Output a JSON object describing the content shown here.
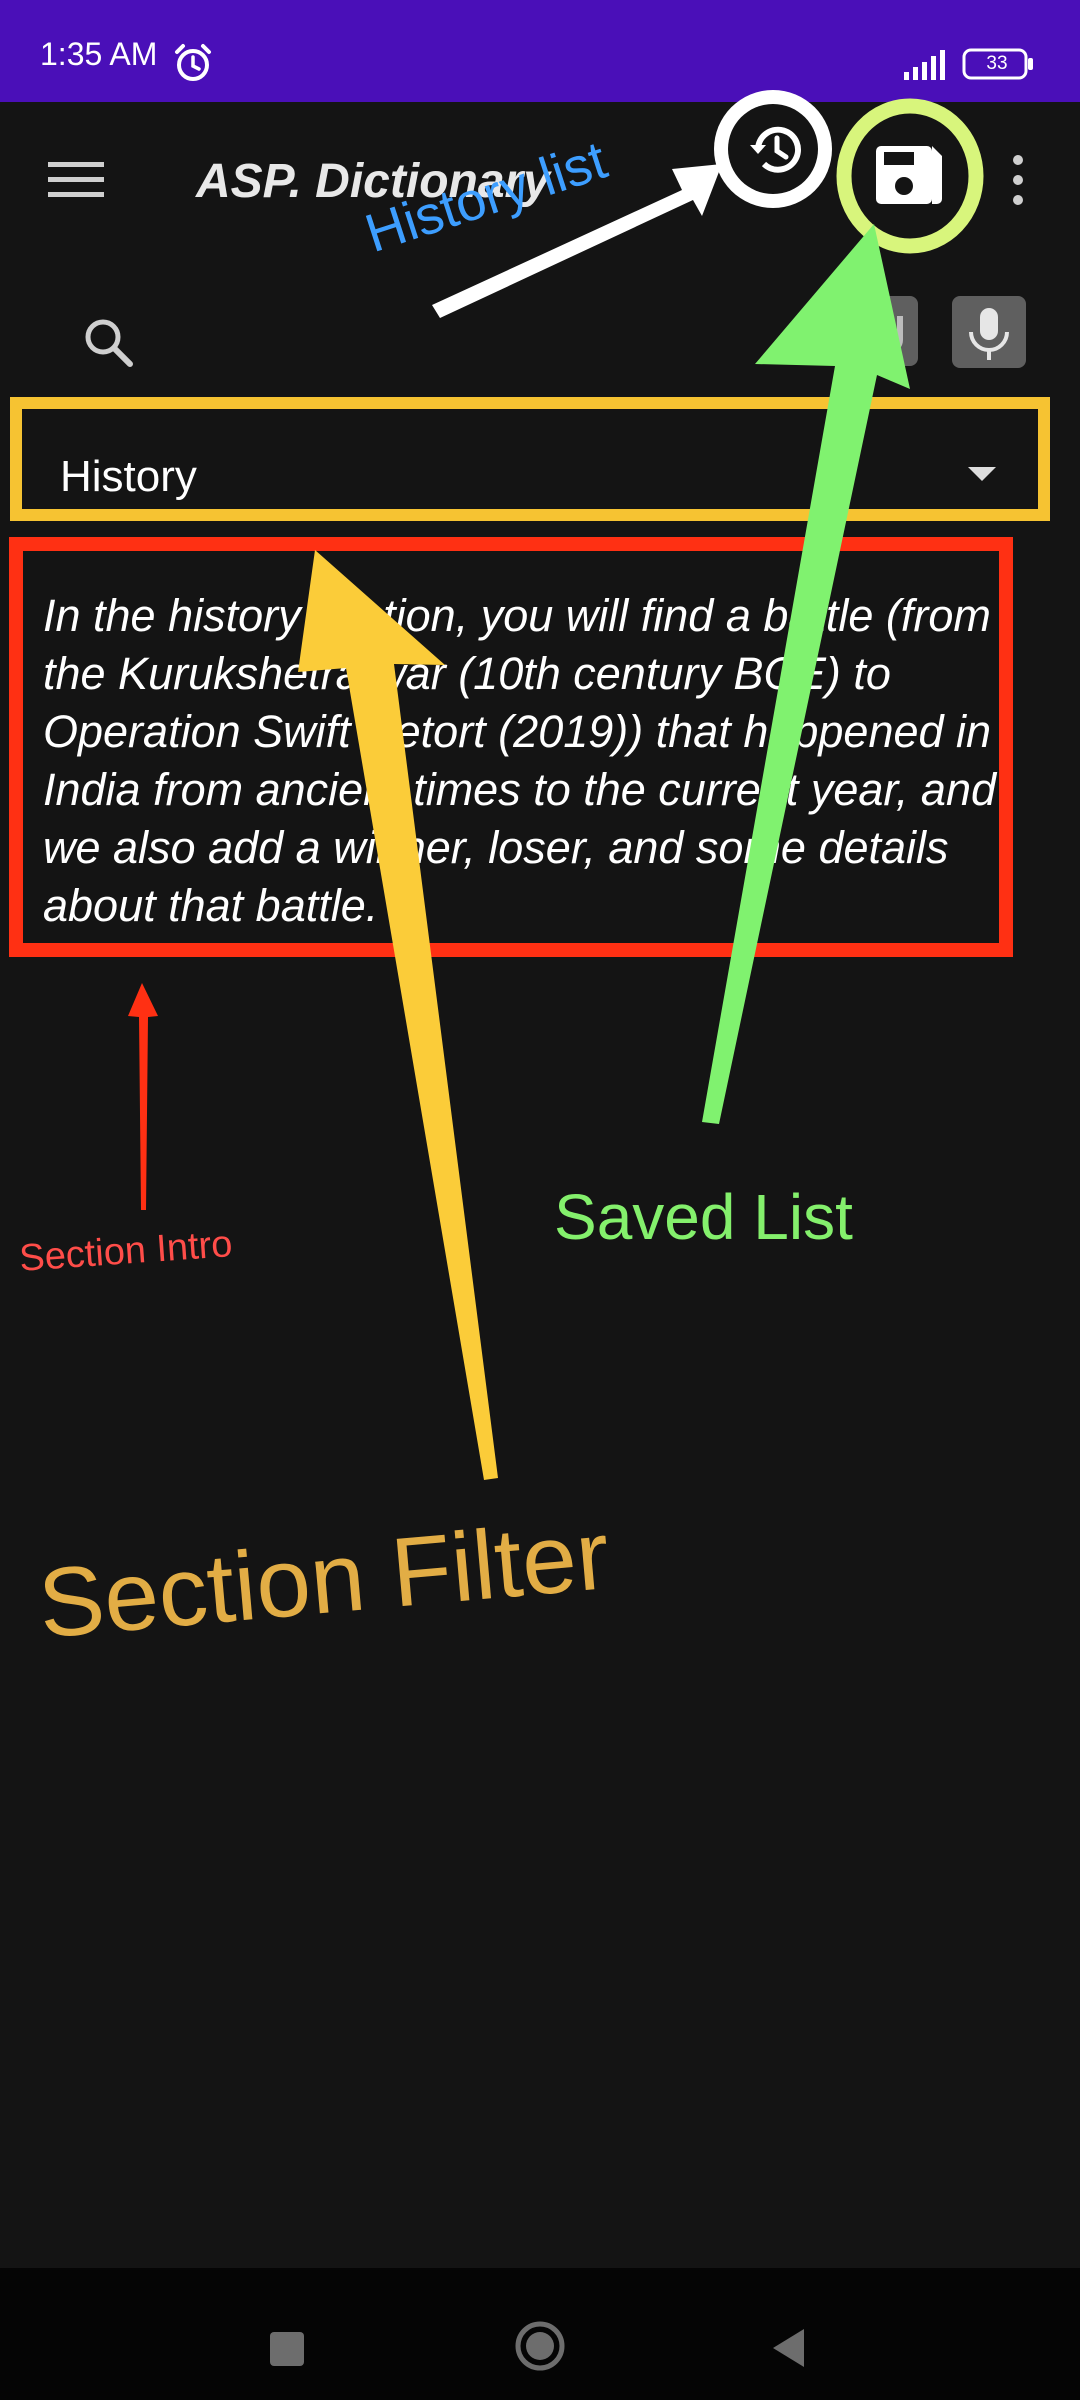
{
  "status_bar": {
    "time": "1:35 AM",
    "battery": "33",
    "icons": [
      "alarm-icon",
      "signal-icon",
      "battery-icon"
    ]
  },
  "app_bar": {
    "title": "ASP. Dictionary",
    "icons": [
      "menu-icon",
      "history-icon",
      "save-icon",
      "more-icon"
    ]
  },
  "search": {
    "icons": [
      "search-icon",
      "keyboard-icon",
      "mic-icon"
    ]
  },
  "section_filter": {
    "selected": "History"
  },
  "section_intro": {
    "text": "In the history section, you will find a battle (from the Kurukshetra war (10th century BCE) to Operation Swift Retort (2019)) that happened in India from ancient times to the current year, and we also add a winner, loser, and some details about that battle."
  },
  "annotations": {
    "history_list": "History list",
    "saved_list": "Saved List",
    "section_intro": "Section Intro",
    "section_filter": "Section Filter"
  },
  "colors": {
    "status_bar": "#4a0fb8",
    "background": "#141414",
    "filter_highlight": "#f6c332",
    "intro_highlight": "#ff3013",
    "saved_highlight": "#d8f57c",
    "saved_arrow": "#7df36d",
    "history_label": "#3d9eff"
  }
}
